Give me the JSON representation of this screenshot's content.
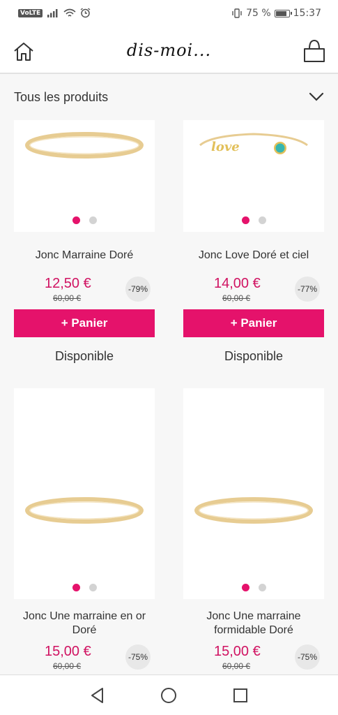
{
  "status_bar": {
    "volte": "VoLTE",
    "battery_text": "75 %",
    "battery_level": 0.75,
    "time": "15:37"
  },
  "header": {
    "logo": "dis-moi...",
    "home_icon": "home-icon",
    "bag_icon": "shopping-bag-icon"
  },
  "filter": {
    "label": "Tous les produits",
    "icon": "chevron-down-icon"
  },
  "products": [
    {
      "name": "Jonc Marraine Doré",
      "price": "12,50 €",
      "old_price": "60,00 €",
      "discount": "-79%",
      "cart_label": "+ Panier",
      "availability": "Disponible"
    },
    {
      "name": "Jonc Love Doré et ciel",
      "price": "14,00 €",
      "old_price": "60,00 €",
      "discount": "-77%",
      "cart_label": "+ Panier",
      "availability": "Disponible"
    },
    {
      "name": "Jonc Une marraine en or Doré",
      "price": "15,00 €",
      "old_price": "60,00 €",
      "discount": "-75%"
    },
    {
      "name": "Jonc Une marraine formidable Doré",
      "price": "15,00 €",
      "old_price": "60,00 €",
      "discount": "-75%"
    }
  ],
  "colors": {
    "accent": "#e5126b",
    "price": "#d01261",
    "gold": "#e9cf95"
  },
  "nav_bar": {
    "back_icon": "back-triangle-icon",
    "home_icon": "home-circle-icon",
    "recents_icon": "recents-square-icon"
  }
}
